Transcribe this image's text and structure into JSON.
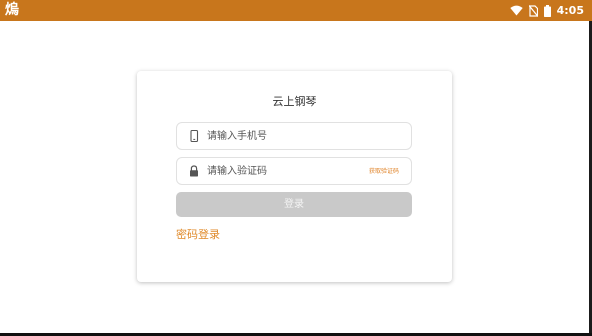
{
  "status_bar": {
    "app_glyph": "熓",
    "time": "4:05",
    "color": "#c8761c"
  },
  "login_card": {
    "title": "云上钢琴",
    "phone": {
      "placeholder": "请输入手机号",
      "value": ""
    },
    "code": {
      "placeholder": "请输入验证码",
      "value": "",
      "get_code_label": "获取验证码"
    },
    "login_label": "登录",
    "password_login_label": "密码登录",
    "accent_color": "#e08a2a",
    "disabled_button_color": "#c9c9c9"
  }
}
